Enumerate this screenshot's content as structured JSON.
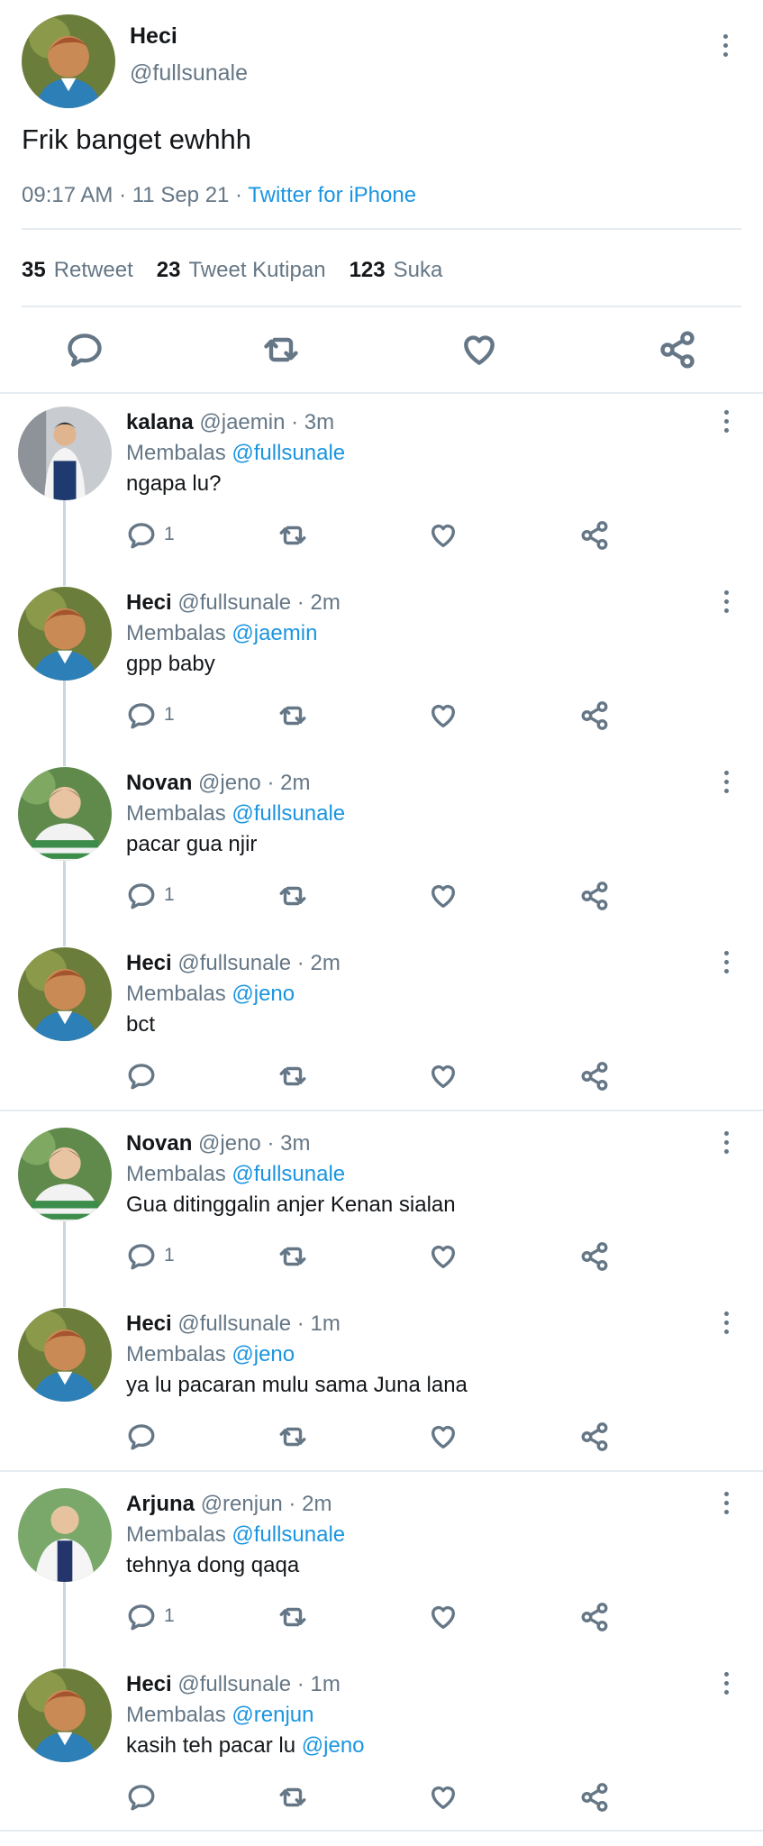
{
  "colors": {
    "accent": "#1b95e0",
    "muted": "#657786",
    "divider": "#e6ecf0"
  },
  "main_tweet": {
    "name": "Heci",
    "handle": "@fullsunale",
    "text": "Frik banget ewhhh",
    "time": "09:17 AM",
    "date": "11 Sep 21",
    "client": "Twitter for iPhone",
    "meta_sep": " · ",
    "stats": {
      "retweets": "35",
      "retweets_label": "Retweet",
      "quotes": "23",
      "quotes_label": "Tweet Kutipan",
      "likes": "123",
      "likes_label": "Suka"
    },
    "actions": [
      "reply-icon",
      "retweet-icon",
      "like-icon",
      "share-icon"
    ]
  },
  "reply_prefix": "Membalas",
  "replies": [
    {
      "name": "kalana",
      "handle": "@jaemin",
      "time": "3m",
      "reply_to": "@fullsunale",
      "text": "ngapa lu?",
      "mention": "",
      "reply_count": "1",
      "avatar": "kalana"
    },
    {
      "name": "Heci",
      "handle": "@fullsunale",
      "time": "2m",
      "reply_to": "@jaemin",
      "text": "gpp baby",
      "mention": "",
      "reply_count": "1",
      "avatar": "heci"
    },
    {
      "name": "Novan",
      "handle": "@jeno",
      "time": "2m",
      "reply_to": "@fullsunale",
      "text": "pacar gua njir",
      "mention": "",
      "reply_count": "1",
      "avatar": "novan"
    },
    {
      "name": "Heci",
      "handle": "@fullsunale",
      "time": "2m",
      "reply_to": "@jeno",
      "text": "bct",
      "mention": "",
      "reply_count": "",
      "avatar": "heci"
    },
    {
      "name": "Novan",
      "handle": "@jeno",
      "time": "3m",
      "reply_to": "@fullsunale",
      "text": "Gua ditinggalin anjer Kenan sialan",
      "mention": "",
      "reply_count": "1",
      "avatar": "novan"
    },
    {
      "name": "Heci",
      "handle": "@fullsunale",
      "time": "1m",
      "reply_to": "@jeno",
      "text": "ya lu pacaran mulu sama Juna lana",
      "mention": "",
      "reply_count": "",
      "avatar": "heci"
    },
    {
      "name": "Arjuna",
      "handle": "@renjun",
      "time": "2m",
      "reply_to": "@fullsunale",
      "text": "tehnya dong qaqa",
      "mention": "",
      "reply_count": "1",
      "avatar": "arjuna"
    },
    {
      "name": "Heci",
      "handle": "@fullsunale",
      "time": "1m",
      "reply_to": "@renjun",
      "text": "kasih teh pacar lu ",
      "mention": "@jeno",
      "reply_count": "",
      "avatar": "heci"
    }
  ]
}
